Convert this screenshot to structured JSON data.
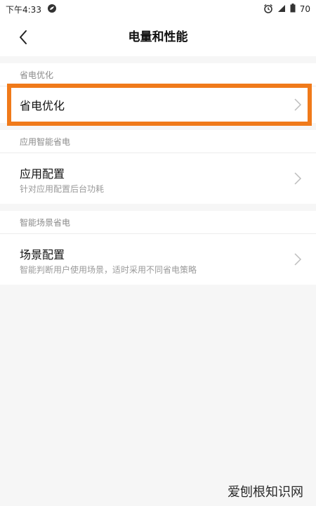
{
  "status_bar": {
    "time": "下午4:33",
    "battery": "70",
    "icons": [
      "app-notification-icon",
      "alarm-icon",
      "signal-icon",
      "battery-icon"
    ]
  },
  "header": {
    "title": "电量和性能",
    "back_icon": "back-arrow-icon"
  },
  "sections": [
    {
      "header": "省电优化",
      "items": [
        {
          "title": "省电优化",
          "subtitle": "",
          "highlighted": true
        }
      ]
    },
    {
      "header": "应用智能省电",
      "items": [
        {
          "title": "应用配置",
          "subtitle": "针对应用配置后台功耗"
        }
      ]
    },
    {
      "header": "智能场景省电",
      "items": [
        {
          "title": "场景配置",
          "subtitle": "智能判断用户使用场景，适时采用不同省电策略"
        }
      ]
    }
  ],
  "highlight_color": "#f07a1a",
  "watermark": "爱刨根知识网"
}
